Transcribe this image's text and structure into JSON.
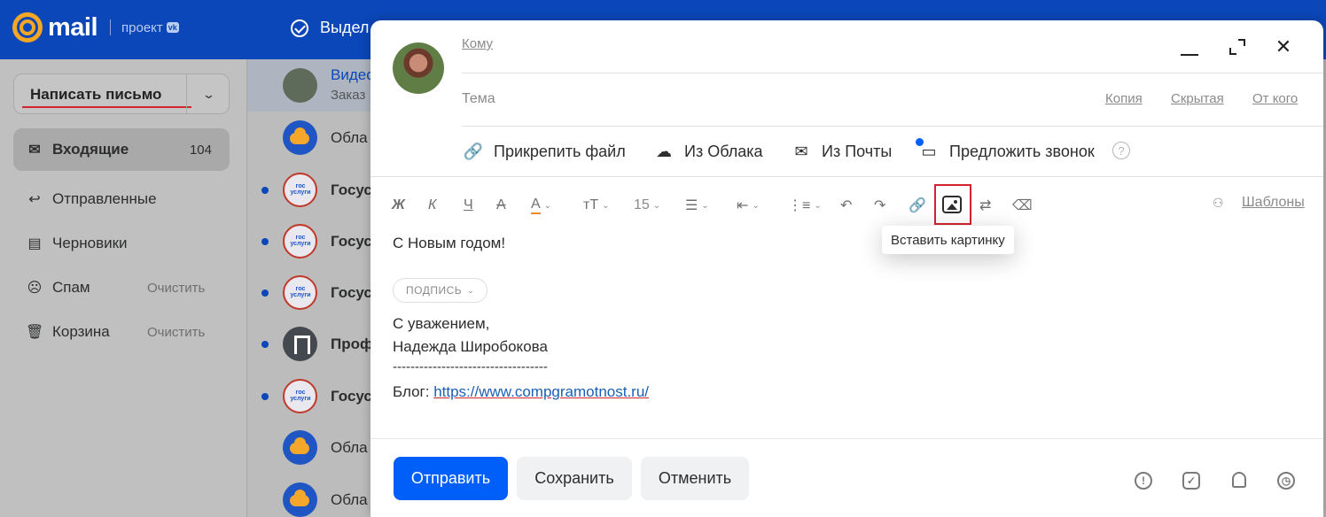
{
  "app": {
    "logo_text": "mail",
    "project_text": "проект",
    "vk_badge": "vk",
    "select_all_label": "Выдел"
  },
  "sidebar": {
    "compose_label": "Написать письмо",
    "folders": [
      {
        "label": "Входящие",
        "count": "104",
        "icon": "inbox-icon"
      },
      {
        "label": "Отправленные",
        "icon": "sent-icon"
      },
      {
        "label": "Черновики",
        "icon": "drafts-icon"
      },
      {
        "label": "Спам",
        "action": "Очистить",
        "icon": "spam-icon"
      },
      {
        "label": "Корзина",
        "action": "Очистить",
        "icon": "trash-icon"
      }
    ]
  },
  "list": {
    "rows": [
      {
        "sender": "Видео",
        "subject": "Заказ"
      },
      {
        "sender": "Обла"
      },
      {
        "sender": "Госус"
      },
      {
        "sender": "Госус"
      },
      {
        "sender": "Госус"
      },
      {
        "sender": "Проф"
      },
      {
        "sender": "Госус"
      },
      {
        "sender": "Обла"
      },
      {
        "sender": "Обла"
      }
    ]
  },
  "compose": {
    "to_label": "Кому",
    "subject_placeholder": "Тема",
    "cc_label": "Копия",
    "bcc_label": "Скрытая",
    "from_label": "От кого",
    "attach": {
      "file": "Прикрепить файл",
      "cloud": "Из Облака",
      "mail": "Из Почты",
      "call": "Предложить звонок"
    },
    "toolbar": {
      "bold": "Ж",
      "italic": "К",
      "underline": "Ч",
      "strike": "А",
      "color": "А",
      "font_size_icon": "тT",
      "font_size": "15",
      "tooltip": "Вставить картинку",
      "templates": "Шаблоны"
    },
    "body": {
      "greeting": "С Новым годом!",
      "signature_chip": "ПОДПИСЬ",
      "sig_line1": "С уважением,",
      "sig_line2": "Надежда Широбокова",
      "sig_divider": "-----------------------------------",
      "blog_label": "Блог:",
      "blog_url": "https://www.compgramotnost.ru/"
    },
    "buttons": {
      "send": "Отправить",
      "save": "Сохранить",
      "cancel": "Отменить"
    }
  },
  "colors": {
    "brand_blue": "#0b47b9",
    "primary_button": "#005ff9",
    "highlight_red": "#d2242c",
    "logo_orange": "#f5a623"
  }
}
